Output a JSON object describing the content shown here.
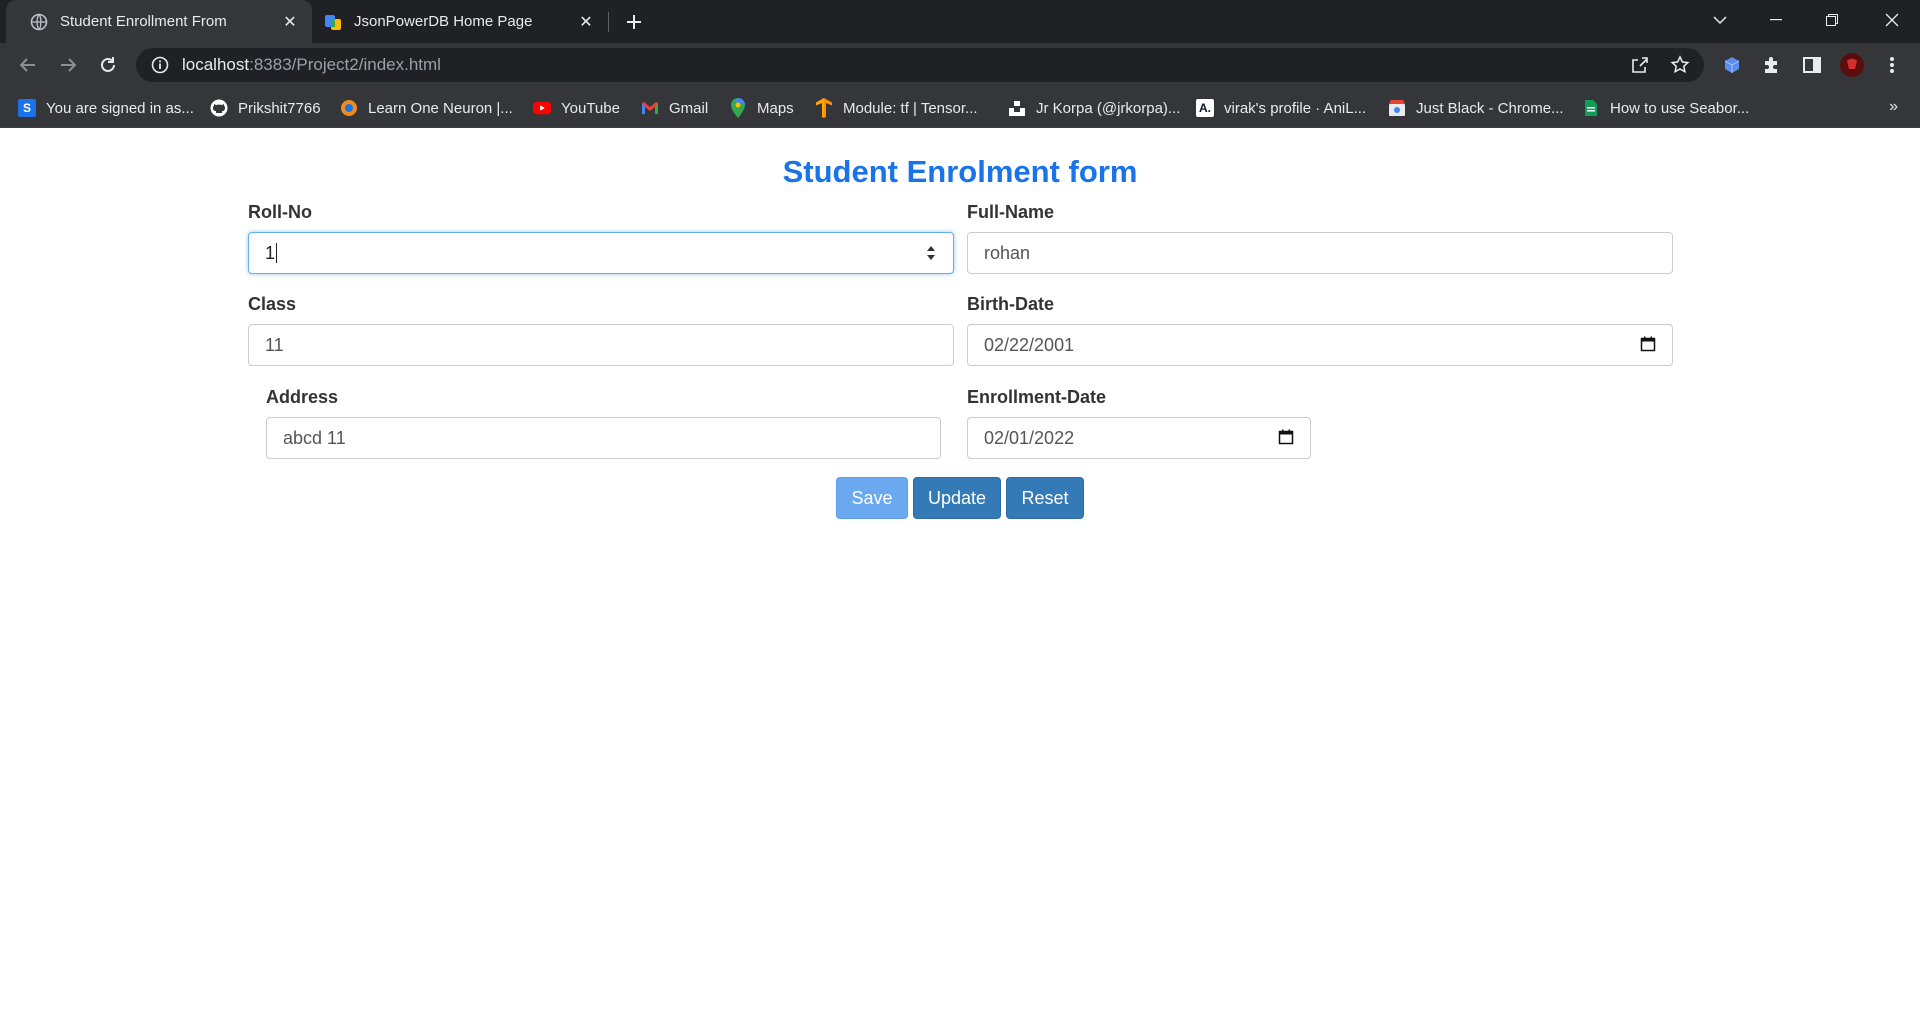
{
  "browser": {
    "tabs": [
      {
        "title": "Student Enrollment From",
        "active": true,
        "icon": "globe-icon"
      },
      {
        "title": "JsonPowerDB Home Page",
        "active": false,
        "icon": "jpdb-icon"
      }
    ],
    "url_host": "localhost",
    "url_rest": ":8383/Project2/index.html",
    "bookmarks": [
      {
        "label": "You are signed in as...",
        "icon": "s-icon",
        "color": "#1a73e8"
      },
      {
        "label": "Prikshit7766",
        "icon": "github-icon",
        "color": "#ffffff"
      },
      {
        "label": "Learn One Neuron |...",
        "icon": "ineuron-icon",
        "color": "#f28b1c"
      },
      {
        "label": "YouTube",
        "icon": "youtube-icon",
        "color": "#ff0000"
      },
      {
        "label": "Gmail",
        "icon": "gmail-icon",
        "color": "#ea4335"
      },
      {
        "label": "Maps",
        "icon": "maps-icon",
        "color": "#34a853"
      },
      {
        "label": "Module: tf  |  Tensor...",
        "icon": "tensorflow-icon",
        "color": "#ff8f00"
      },
      {
        "label": "Jr Korpa (@jrkorpa)...",
        "icon": "unsplash-icon",
        "color": "#ffffff"
      },
      {
        "label": "virak's profile · AniL...",
        "icon": "anilist-icon",
        "color": "#ffffff"
      },
      {
        "label": "Just Black - Chrome...",
        "icon": "webstore-icon",
        "color": "#ea4335"
      },
      {
        "label": "How to use Seabor...",
        "icon": "doc-icon",
        "color": "#0f9d58"
      }
    ],
    "bookmarks_more": "»"
  },
  "form": {
    "title": "Student Enrolment form",
    "roll_label": "Roll-No",
    "roll_value": "1",
    "name_label": "Full-Name",
    "name_value": "rohan",
    "class_label": "Class",
    "class_value": "11",
    "birth_label": "Birth-Date",
    "birth_value": "02/22/2001",
    "address_label": "Address",
    "address_value": "abcd 11",
    "enroll_label": "Enrollment-Date",
    "enroll_value": "02/01/2022",
    "save_label": "Save",
    "update_label": "Update",
    "reset_label": "Reset"
  },
  "colors": {
    "title": "#1a73e8",
    "button_primary": "#337ab7",
    "button_save_disabled": "#6aa9ef"
  }
}
